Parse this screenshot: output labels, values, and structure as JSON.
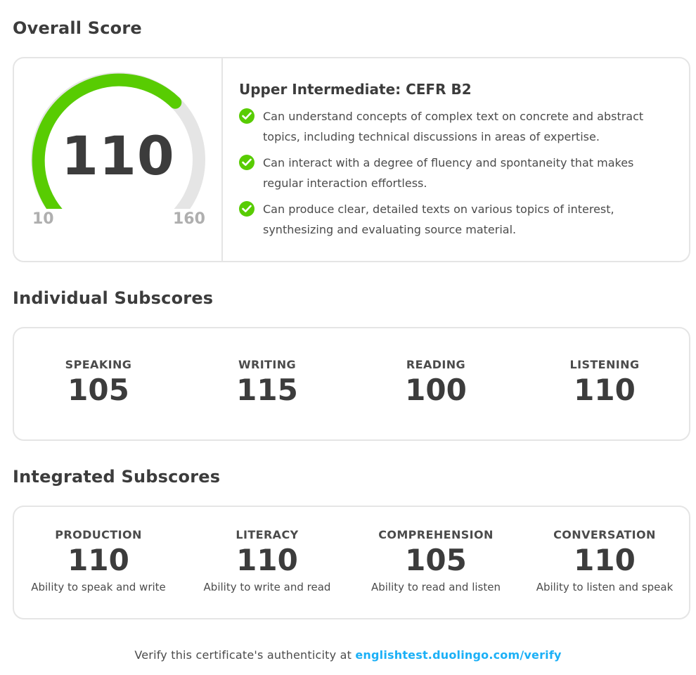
{
  "overall": {
    "title": "Overall Score",
    "score": "110",
    "min": "10",
    "max": "160",
    "colors": {
      "fill": "#58cc02",
      "track": "#e5e5e5"
    },
    "level_title": "Upper Intermediate: CEFR B2",
    "criteria": [
      {
        "line1": "Can understand concepts of complex text on concrete and abstract",
        "line2": "topics, including technical discussions in areas of expertise."
      },
      {
        "line1": "Can interact with a degree of fluency and spontaneity that makes",
        "line2": "regular interaction effortless."
      },
      {
        "line1": "Can produce clear, detailed texts on various topics of interest,",
        "line2": "synthesizing and evaluating source material."
      }
    ]
  },
  "individual": {
    "title": "Individual Subscores",
    "items": [
      {
        "label": "SPEAKING",
        "value": "105"
      },
      {
        "label": "WRITING",
        "value": "115"
      },
      {
        "label": "READING",
        "value": "100"
      },
      {
        "label": "LISTENING",
        "value": "110"
      }
    ]
  },
  "integrated": {
    "title": "Integrated Subscores",
    "items": [
      {
        "label": "PRODUCTION",
        "value": "110",
        "desc": "Ability to speak and write"
      },
      {
        "label": "LITERACY",
        "value": "110",
        "desc": "Ability to write and read"
      },
      {
        "label": "COMPREHENSION",
        "value": "105",
        "desc": "Ability to read and listen"
      },
      {
        "label": "CONVERSATION",
        "value": "110",
        "desc": "Ability to listen and speak"
      }
    ]
  },
  "footer": {
    "text": "Verify this certificate's authenticity at ",
    "link": "englishtest.duolingo.com/verify",
    "link_color": "#1cb0f6"
  }
}
